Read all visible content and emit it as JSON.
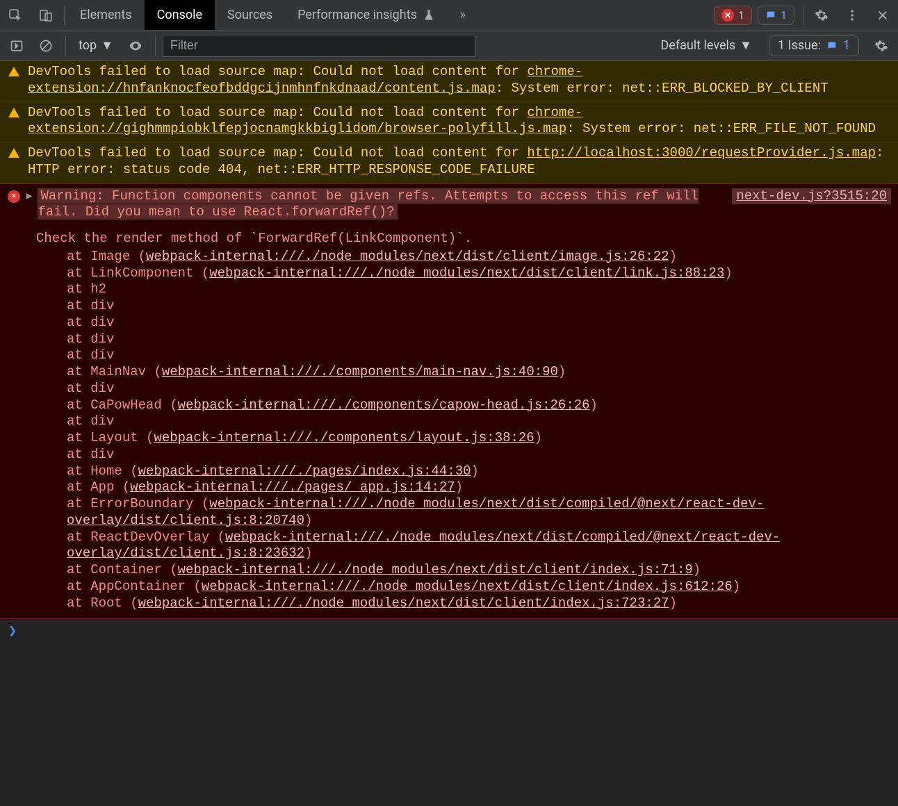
{
  "tabs": {
    "elements": "Elements",
    "console": "Console",
    "sources": "Sources",
    "perf_insights": "Performance insights"
  },
  "badges": {
    "error_count": "1",
    "issue_count": "1"
  },
  "subbar": {
    "context": "top",
    "filter_placeholder": "Filter",
    "levels": "Default levels",
    "issue_label": "1 Issue:",
    "issue_count": "1"
  },
  "warnings": [
    {
      "prefix": "DevTools failed to load source map: Could not load content for ",
      "link": "chrome-extension://hnfanknocfeofbddgcijnmhnfnkdnaad/content.js.map",
      "suffix": ": System error: net::ERR_BLOCKED_BY_CLIENT"
    },
    {
      "prefix": "DevTools failed to load source map: Could not load content for ",
      "link": "chrome-extension://gighmmpiobklfepjocnamgkkbiglidom/browser-polyfill.js.map",
      "suffix": ": System error: net::ERR_FILE_NOT_FOUND"
    },
    {
      "prefix": "DevTools failed to load source map: Could not load content for ",
      "link": "http://localhost:3000/requestProvider.js.map",
      "suffix": ": HTTP error: status code 404, net::ERR_HTTP_RESPONSE_CODE_FAILURE"
    }
  ],
  "error": {
    "source": "next-dev.js?3515:20",
    "headline": "Warning: Function components cannot be given refs. Attempts to access this ref will fail. Did you mean to use React.forwardRef()?",
    "check_line": "Check the render method of `ForwardRef(LinkComponent)`.",
    "stack": [
      {
        "text": "at Image (",
        "link": "webpack-internal:///./node_modules/next/dist/client/image.js:26:22",
        "tail": ")"
      },
      {
        "text": "at LinkComponent (",
        "link": "webpack-internal:///./node_modules/next/dist/client/link.js:88:23",
        "tail": ")"
      },
      {
        "text": "at h2"
      },
      {
        "text": "at div"
      },
      {
        "text": "at div"
      },
      {
        "text": "at div"
      },
      {
        "text": "at div"
      },
      {
        "text": "at MainNav (",
        "link": "webpack-internal:///./components/main-nav.js:40:90",
        "tail": ")"
      },
      {
        "text": "at div"
      },
      {
        "text": "at CaPowHead (",
        "link": "webpack-internal:///./components/capow-head.js:26:26",
        "tail": ")"
      },
      {
        "text": "at div"
      },
      {
        "text": "at Layout (",
        "link": "webpack-internal:///./components/layout.js:38:26",
        "tail": ")"
      },
      {
        "text": "at div"
      },
      {
        "text": "at Home (",
        "link": "webpack-internal:///./pages/index.js:44:30",
        "tail": ")"
      },
      {
        "text": "at App (",
        "link": "webpack-internal:///./pages/_app.js:14:27",
        "tail": ")"
      },
      {
        "wrap": true,
        "text": "at ErrorBoundary (",
        "link": "webpack-internal:///./node_modules/next/dist/compiled/@next/react-dev-overlay/dist/client.js:8:20740",
        "tail": ")"
      },
      {
        "wrap": true,
        "text": "at ReactDevOverlay (",
        "link": "webpack-internal:///./node_modules/next/dist/compiled/@next/react-dev-overlay/dist/client.js:8:23632",
        "tail": ")"
      },
      {
        "text": "at Container (",
        "link": "webpack-internal:///./node_modules/next/dist/client/index.js:71:9",
        "tail": ")"
      },
      {
        "text": "at AppContainer (",
        "link": "webpack-internal:///./node_modules/next/dist/client/index.js:612:26",
        "tail": ")"
      },
      {
        "text": "at Root (",
        "link": "webpack-internal:///./node_modules/next/dist/client/index.js:723:27",
        "tail": ")"
      }
    ]
  }
}
